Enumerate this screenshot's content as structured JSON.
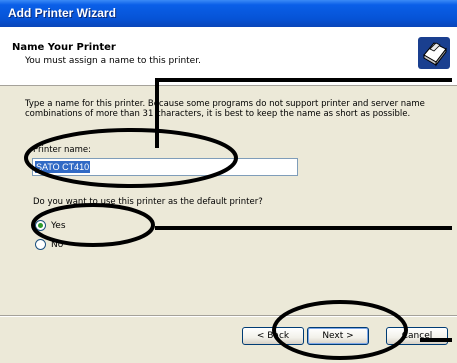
{
  "window": {
    "title": "Add Printer Wizard"
  },
  "header": {
    "title": "Name Your Printer",
    "subtitle": "You must assign a name to this printer.",
    "icon": "printer-icon"
  },
  "body": {
    "description": "Type a name for this printer. Because some programs do not support printer and server name combinations of more than 31 characters, it is best to keep the name as short as possible.",
    "printer_name_label": "Printer name:",
    "printer_name_value": "SATO CT410",
    "default_question": "Do you want to use this printer as the default printer?",
    "radio_yes": "Yes",
    "radio_no": "No",
    "selected": "Yes"
  },
  "buttons": {
    "back": "< Back",
    "next": "Next >",
    "cancel": "Cancel"
  },
  "colors": {
    "titlebar": "#0653d6",
    "dialog_bg": "#ece9d8",
    "selection": "#316ac5"
  }
}
